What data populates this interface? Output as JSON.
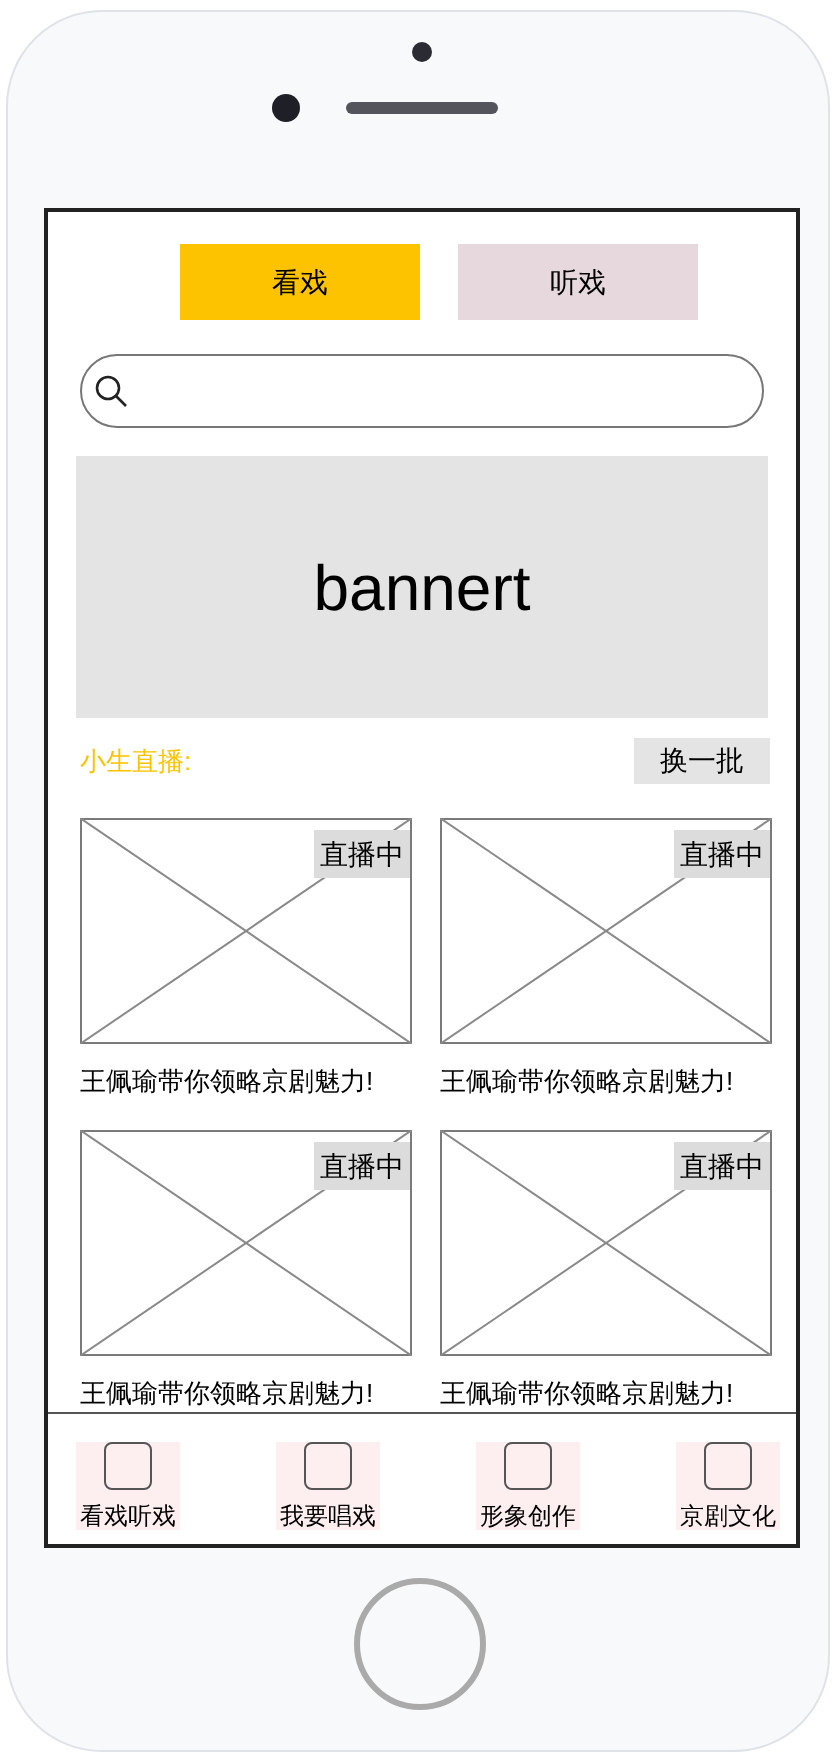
{
  "tabs": [
    {
      "label": "看戏",
      "selected": true
    },
    {
      "label": "听戏",
      "selected": false
    }
  ],
  "banner": {
    "text": "bannert"
  },
  "live_section": {
    "title": "小生直播:",
    "refresh_button": "换一批"
  },
  "cards": [
    {
      "badge": "直播中",
      "title": "王佩瑜带你领略京剧魅力!"
    },
    {
      "badge": "直播中",
      "title": "王佩瑜带你领略京剧魅力!"
    },
    {
      "badge": "直播中",
      "title": "王佩瑜带你领略京剧魅力!"
    },
    {
      "badge": "直播中",
      "title": "王佩瑜带你领略京剧魅力!"
    }
  ],
  "bottom_nav": [
    {
      "label": "看戏听戏"
    },
    {
      "label": "我要唱戏"
    },
    {
      "label": "形象创作"
    },
    {
      "label": "京剧文化"
    }
  ]
}
